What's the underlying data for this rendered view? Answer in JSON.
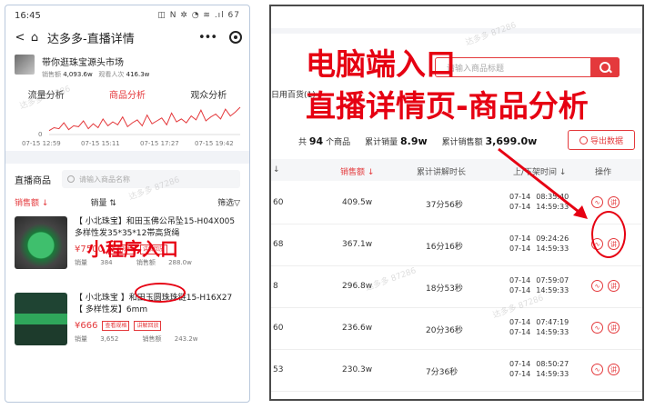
{
  "mini": {
    "status_time": "16:45",
    "status_icons": "◫ N ✲ ◔ ≋ .ıl 67",
    "nav_title": "达多多-直播详情",
    "shop": {
      "name": "带你逛珠宝源头市场",
      "sales_label": "销售额",
      "sales_value": "4,093.6w",
      "viewers_label": "观看人次",
      "viewers_value": "416.3w"
    },
    "tabs": [
      "流量分析",
      "商品分析",
      "观众分析"
    ],
    "active_tab": 1,
    "spark_times": [
      "07-15 12:59",
      "07-15 15:11",
      "07-15 17:27",
      "07-15 19:42"
    ],
    "spark_zero": "0",
    "spark_values": [
      4,
      7,
      6,
      12,
      5,
      9,
      8,
      14,
      6,
      11,
      7,
      16,
      9,
      13,
      10,
      18,
      8,
      12,
      15,
      9,
      20,
      11,
      14,
      17,
      10,
      22,
      13,
      16,
      12,
      19,
      15,
      25,
      14,
      18,
      21,
      16,
      26,
      19,
      23,
      28
    ],
    "live_goods_title": "直播商品",
    "search_placeholder": "请输入商品名称",
    "sort": {
      "sales_amount": "销售额",
      "sales_volume": "销量",
      "filter": "筛选"
    },
    "sort_arrows": {
      "sales_amount": "↓",
      "sales_volume": "⇅",
      "filter": "▽"
    },
    "products": [
      {
        "title": "【 小北珠宝】和田玉佛公吊坠15-H04X005多样性发35*35*12帯高货绳",
        "price": "¥7500",
        "tag1": "查看规格",
        "tag2": "讲解回放",
        "vol_label": "销量",
        "vol": "384",
        "amt_label": "销售额",
        "amt": "288.0w"
      },
      {
        "title": "【 小北珠宝 】和田玉圆珠珠链15-H16X27【 多样性发】6mm",
        "price": "¥666",
        "tag1": "查看规格",
        "tag2": "讲解回放",
        "vol_label": "销量",
        "vol": "3,652",
        "amt_label": "销售额",
        "amt": "243.2w"
      }
    ]
  },
  "desk": {
    "search_placeholder": "请输入商品标题",
    "filter_label": "日用百货(1)",
    "summary": {
      "total_prefix": "共",
      "total": "94",
      "total_suffix": "个商品",
      "vol_label": "累计销量",
      "vol": "8.9w",
      "amt_label": "累计销售额",
      "amt": "3,699.0w"
    },
    "export_label": "导出数据",
    "headers": {
      "sales": "销售额",
      "duration": "累计讲解时长",
      "period": "上/下架时间",
      "op": "操作"
    },
    "header_arrows": {
      "first": "↓",
      "sales": "↓",
      "period": "↓"
    },
    "rows": [
      {
        "first": "60",
        "sales": "409.5w",
        "dur": "37分56秒",
        "d1": "07-14",
        "t1": "08:35:40",
        "d2": "07-14",
        "t2": "14:59:33"
      },
      {
        "first": "68",
        "sales": "367.1w",
        "dur": "16分16秒",
        "d1": "07-14",
        "t1": "09:24:26",
        "d2": "07-14",
        "t2": "14:59:33"
      },
      {
        "first": "8",
        "sales": "296.8w",
        "dur": "18分53秒",
        "d1": "07-14",
        "t1": "07:59:07",
        "d2": "07-14",
        "t2": "14:59:33"
      },
      {
        "first": "60",
        "sales": "236.6w",
        "dur": "20分36秒",
        "d1": "07-14",
        "t1": "07:47:19",
        "d2": "07-14",
        "t2": "14:59:33"
      },
      {
        "first": "53",
        "sales": "230.3w",
        "dur": "7分36秒",
        "d1": "07-14",
        "t1": "08:50:27",
        "d2": "07-14",
        "t2": "14:59:33"
      }
    ],
    "op_icons": {
      "trend": "∿",
      "explain": "讲"
    }
  },
  "annotations": {
    "pc_entry": "电脑端入口",
    "pc_page": "直播详情页-商品分析",
    "mini_entry": "小程序入口",
    "watermark": "达多多 87286",
    "color": "#e60012"
  }
}
